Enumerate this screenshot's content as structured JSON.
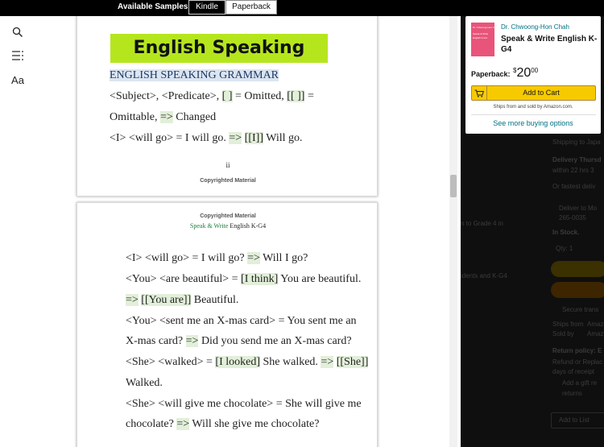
{
  "topbar": {
    "available_samples_label": "Available Samples:",
    "formats": [
      "Kindle",
      "Paperback"
    ]
  },
  "sidebar": {
    "tools": [
      {
        "icon": "search-icon"
      },
      {
        "icon": "table-of-contents-icon"
      },
      {
        "label": "Aa",
        "icon": "text-settings-icon"
      }
    ]
  },
  "reader": {
    "page1": {
      "banner": "English Speaking",
      "heading": "ENGLISH SPEAKING GRAMMAR",
      "line1": {
        "pre": "<Subject>, <Predicate>, ",
        "h1": "[ ]",
        "mid": " = Omitted, ",
        "h2": "[[ ]]",
        "post": " ="
      },
      "line2": {
        "pre": "Omittable, ",
        "h1": "=>",
        "post": " Changed"
      },
      "line3": {
        "pre": "<I> <will go> = I will go. ",
        "h1": "=>",
        "mid": " ",
        "h2": "[[I]]",
        "post": " Will go."
      },
      "page_number": "ii",
      "copyright": "Copyrighted Material"
    },
    "page2": {
      "copyright": "Copyrighted Material",
      "running_head_green": "Speak & Write",
      "running_head_rest": " English K-G4",
      "l1": {
        "pre": "<I> <will go> = I will go? ",
        "h1": "=>",
        "post": " Will I go?"
      },
      "l2": {
        "pre": "<You> <are beautiful> = ",
        "h1": "[I think]",
        "post": " You are beautiful."
      },
      "l3": {
        "h1": "=>",
        "mid": " ",
        "h2": "[[You are]]",
        "post": " Beautiful."
      },
      "l4": {
        "pre": "<You> <sent me an X-mas card> = You sent me an"
      },
      "l5": {
        "pre": "X-mas card? ",
        "h1": "=>",
        "post": " Did you send me an X-mas card?"
      },
      "l6": {
        "pre": "<She> <walked> = ",
        "h1": "[I looked]",
        "mid": " She walked. ",
        "h2": "=>",
        "mid2": " ",
        "h3": "[[She]]"
      },
      "l7": {
        "pre": "Walked."
      },
      "l8": {
        "pre": "<She> <will give me chocolate> = She will give me"
      },
      "l9": {
        "pre": "chocolate? ",
        "h1": "=>",
        "post": " Will she give me chocolate?"
      }
    }
  },
  "product": {
    "author": "Dr. Chwoong-Hon Chah",
    "title": "Speak & Write English K-G4",
    "cover_lines": [
      "Dr. Chwoong-Hon Chah",
      "Speak & Write",
      "English K-G4"
    ],
    "price_label": "Paperback:",
    "price_symbol": "$",
    "price_whole": "20",
    "price_cents": "00",
    "add_to_cart": "Add to Cart",
    "ships_from": "Ships from and sold by Amazon.com.",
    "more_options": "See more buying options"
  },
  "background_page": {
    "items": [
      {
        "text": "Shipping to Japa",
        "bold": false
      },
      {
        "text": "Delivery Thursd",
        "bold": true
      },
      {
        "text": "within 22 hrs 3",
        "bold": false
      },
      {
        "text": "Or fastest deliv",
        "bold": false
      },
      {
        "text": "Deliver to Mo",
        "bold": false
      },
      {
        "text": "265-0035",
        "bold": false
      },
      {
        "text": "n to Grade 4 in",
        "bold": false
      },
      {
        "text": "In Stock.",
        "bold": true
      },
      {
        "text": "Qty: 1",
        "bold": false
      },
      {
        "text": "idents and K-G4",
        "bold": false
      },
      {
        "text": "Secure trans",
        "bold": false
      },
      {
        "text": "Ships from",
        "bold": false
      },
      {
        "text": "Amaz",
        "bold": false
      },
      {
        "text": "Sold by",
        "bold": false
      },
      {
        "text": "Amaz",
        "bold": false
      },
      {
        "text": "Return policy: E",
        "bold": true
      },
      {
        "text": "Refund or Replac",
        "bold": false
      },
      {
        "text": "days of receipt",
        "bold": false
      },
      {
        "text": "Add a gift re",
        "bold": false
      },
      {
        "text": "returns",
        "bold": false
      },
      {
        "text": "Add to List",
        "bold": false
      }
    ]
  },
  "colors": {
    "banner": "#b5e61d",
    "highlight": "#e2efd9",
    "cart_button": "#f7ca00",
    "link": "#007185"
  }
}
